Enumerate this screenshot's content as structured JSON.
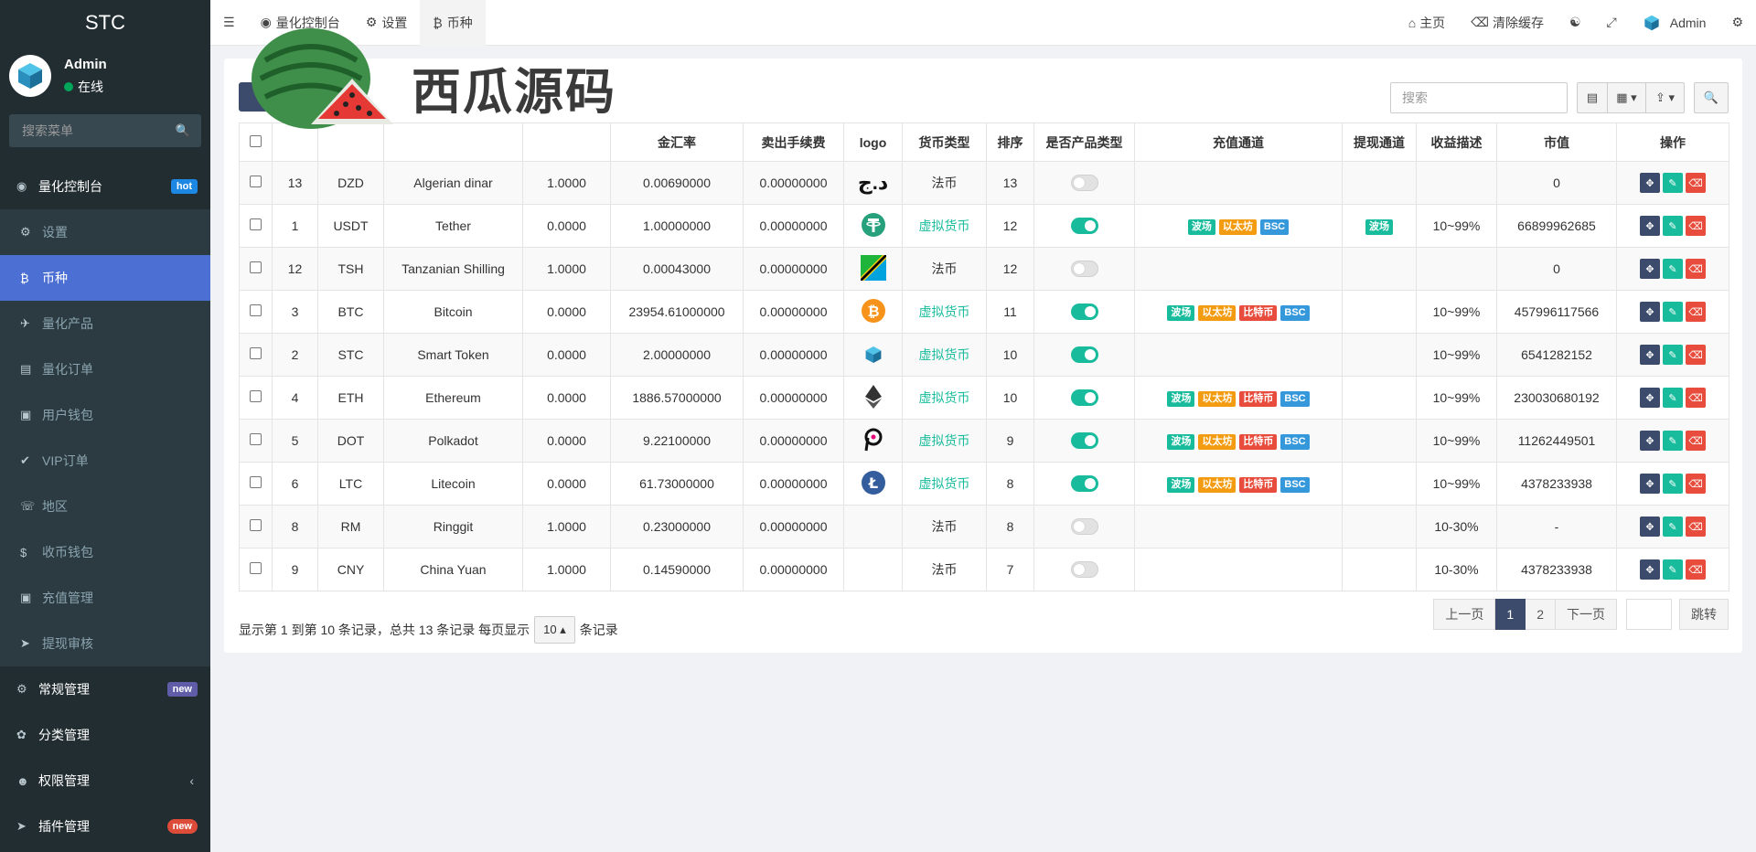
{
  "brand": "STC",
  "user": {
    "name": "Admin",
    "status": "在线"
  },
  "sidebar_search_placeholder": "搜索菜单",
  "menu": [
    {
      "label": "量化控制台",
      "badge": "hot"
    },
    {
      "label": "设置"
    },
    {
      "label": "币种",
      "active": true
    },
    {
      "label": "量化产品"
    },
    {
      "label": "量化订单"
    },
    {
      "label": "用户钱包"
    },
    {
      "label": "VIP订单"
    },
    {
      "label": "地区"
    },
    {
      "label": "收币钱包"
    },
    {
      "label": "充值管理"
    },
    {
      "label": "提现审核"
    },
    {
      "label": "常规管理",
      "badge": "new"
    },
    {
      "label": "分类管理"
    },
    {
      "label": "权限管理"
    },
    {
      "label": "插件管理",
      "badge": "new"
    }
  ],
  "topnav": {
    "tabs": [
      "量化控制台",
      "设置",
      "币种"
    ],
    "home": "主页",
    "clear_cache": "清除缓存",
    "admin": "Admin"
  },
  "watermark_text": "西瓜源码",
  "table_search_placeholder": "搜索",
  "columns": [
    "",
    "",
    "",
    "",
    "金汇率",
    "卖出手续费",
    "logo",
    "货币类型",
    "排序",
    "是否产品类型",
    "充值通道",
    "提现通道",
    "收益描述",
    "市值",
    "操作"
  ],
  "rows": [
    {
      "id": "13",
      "code": "DZD",
      "name": "Algerian dinar",
      "v1": "1.0000",
      "rate": "0.00690000",
      "fee": "0.00000000",
      "logo": "dzd",
      "type": "法币",
      "sort": "13",
      "product": false,
      "recharge": [],
      "withdraw": [],
      "desc": "",
      "cap": "0"
    },
    {
      "id": "1",
      "code": "USDT",
      "name": "Tether",
      "v1": "0.0000",
      "rate": "1.00000000",
      "fee": "0.00000000",
      "logo": "usdt",
      "type": "虚拟货币",
      "sort": "12",
      "product": true,
      "recharge": [
        "波场",
        "以太坊",
        "BSC"
      ],
      "withdraw": [
        "波场"
      ],
      "desc": "10~99%",
      "cap": "66899962685"
    },
    {
      "id": "12",
      "code": "TSH",
      "name": "Tanzanian Shilling",
      "v1": "1.0000",
      "rate": "0.00043000",
      "fee": "0.00000000",
      "logo": "tsh",
      "type": "法币",
      "sort": "12",
      "product": false,
      "recharge": [],
      "withdraw": [],
      "desc": "",
      "cap": "0"
    },
    {
      "id": "3",
      "code": "BTC",
      "name": "Bitcoin",
      "v1": "0.0000",
      "rate": "23954.61000000",
      "fee": "0.00000000",
      "logo": "btc",
      "type": "虚拟货币",
      "sort": "11",
      "product": true,
      "recharge": [
        "波场",
        "以太坊",
        "比特币",
        "BSC"
      ],
      "withdraw": [],
      "desc": "10~99%",
      "cap": "457996117566"
    },
    {
      "id": "2",
      "code": "STC",
      "name": "Smart Token",
      "v1": "0.0000",
      "rate": "2.00000000",
      "fee": "0.00000000",
      "logo": "stc",
      "type": "虚拟货币",
      "sort": "10",
      "product": true,
      "recharge": [],
      "withdraw": [],
      "desc": "10~99%",
      "cap": "6541282152"
    },
    {
      "id": "4",
      "code": "ETH",
      "name": "Ethereum",
      "v1": "0.0000",
      "rate": "1886.57000000",
      "fee": "0.00000000",
      "logo": "eth",
      "type": "虚拟货币",
      "sort": "10",
      "product": true,
      "recharge": [
        "波场",
        "以太坊",
        "比特币",
        "BSC"
      ],
      "withdraw": [],
      "desc": "10~99%",
      "cap": "230030680192"
    },
    {
      "id": "5",
      "code": "DOT",
      "name": "Polkadot",
      "v1": "0.0000",
      "rate": "9.22100000",
      "fee": "0.00000000",
      "logo": "dot",
      "type": "虚拟货币",
      "sort": "9",
      "product": true,
      "recharge": [
        "波场",
        "以太坊",
        "比特币",
        "BSC"
      ],
      "withdraw": [],
      "desc": "10~99%",
      "cap": "11262449501"
    },
    {
      "id": "6",
      "code": "LTC",
      "name": "Litecoin",
      "v1": "0.0000",
      "rate": "61.73000000",
      "fee": "0.00000000",
      "logo": "ltc",
      "type": "虚拟货币",
      "sort": "8",
      "product": true,
      "recharge": [
        "波场",
        "以太坊",
        "比特币",
        "BSC"
      ],
      "withdraw": [],
      "desc": "10~99%",
      "cap": "4378233938"
    },
    {
      "id": "8",
      "code": "RM",
      "name": "Ringgit",
      "v1": "1.0000",
      "rate": "0.23000000",
      "fee": "0.00000000",
      "logo": "",
      "type": "法币",
      "sort": "8",
      "product": false,
      "recharge": [],
      "withdraw": [],
      "desc": "10-30%",
      "cap": "-"
    },
    {
      "id": "9",
      "code": "CNY",
      "name": "China Yuan",
      "v1": "1.0000",
      "rate": "0.14590000",
      "fee": "0.00000000",
      "logo": "",
      "type": "法币",
      "sort": "7",
      "product": false,
      "recharge": [],
      "withdraw": [],
      "desc": "10-30%",
      "cap": "4378233938"
    }
  ],
  "footer": {
    "info": "显示第 1 到第 10 条记录，总共 13 条记录 每页显示",
    "page_size": "10",
    "suffix": "条记录"
  },
  "pagination": {
    "prev": "上一页",
    "pages": [
      "1",
      "2"
    ],
    "next": "下一页",
    "jump": "跳转"
  },
  "colors": {
    "sidebar": "#222d32",
    "active": "#4c6fd3",
    "green": "#18bc9c",
    "orange": "#f39c12",
    "red": "#e74c3c",
    "blue": "#3498db"
  }
}
